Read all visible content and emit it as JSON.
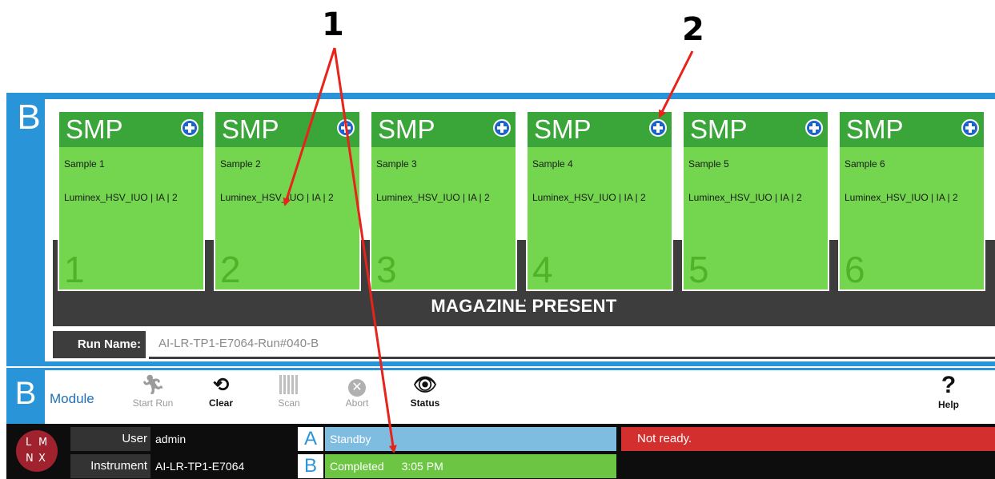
{
  "callouts": [
    "1",
    "2"
  ],
  "module_panel": {
    "letter": "B",
    "cards": [
      {
        "title": "SMP",
        "name": "Sample 1",
        "assay": "Luminex_HSV_IUO | IA | 2",
        "slot": "1"
      },
      {
        "title": "SMP",
        "name": "Sample 2",
        "assay": "Luminex_HSV_IUO | IA | 2",
        "slot": "2"
      },
      {
        "title": "SMP",
        "name": "Sample 3",
        "assay": "Luminex_HSV_IUO | IA | 2",
        "slot": "3"
      },
      {
        "title": "SMP",
        "name": "Sample 4",
        "assay": "Luminex_HSV_IUO | IA | 2",
        "slot": "4"
      },
      {
        "title": "SMP",
        "name": "Sample 5",
        "assay": "Luminex_HSV_IUO | IA | 2",
        "slot": "5"
      },
      {
        "title": "SMP",
        "name": "Sample 6",
        "assay": "Luminex_HSV_IUO | IA | 2",
        "slot": "6"
      }
    ],
    "magazine_status": "MAGAZINE PRESENT",
    "run_name_label": "Run Name:",
    "run_name_value": "AI-LR-TP1-E7064-Run#040-B"
  },
  "toolbar": {
    "letter": "B",
    "module_label": "Module",
    "start_run": "Start Run",
    "clear": "Clear",
    "scan": "Scan",
    "abort": "Abort",
    "status": "Status",
    "help": "Help"
  },
  "statusbar": {
    "logo": [
      "L",
      "M",
      "N",
      "X"
    ],
    "user_label": "User",
    "user_value": "admin",
    "instrument_label": "Instrument",
    "instrument_value": "AI-LR-TP1-E7064",
    "module_a": {
      "letter": "A",
      "text": "Standby"
    },
    "module_b": {
      "letter": "B",
      "text": "Completed",
      "time": "3:05 PM"
    },
    "alert": "Not ready."
  },
  "colors": {
    "accent_blue": "#2a94d8",
    "card_green": "#74d64f",
    "card_header_green": "#3aa63a",
    "standby_blue": "#7fbde0",
    "completed_green": "#6cc644",
    "alert_red": "#d32f2f",
    "logo_red": "#a0222e"
  },
  "icons": {
    "add": "plus-circle-icon",
    "start_run": "running-person-icon",
    "clear": "rotate-icon",
    "scan": "qr-code-icon",
    "abort": "x-circle-icon",
    "status": "eye-icon",
    "help": "question-mark-icon"
  }
}
